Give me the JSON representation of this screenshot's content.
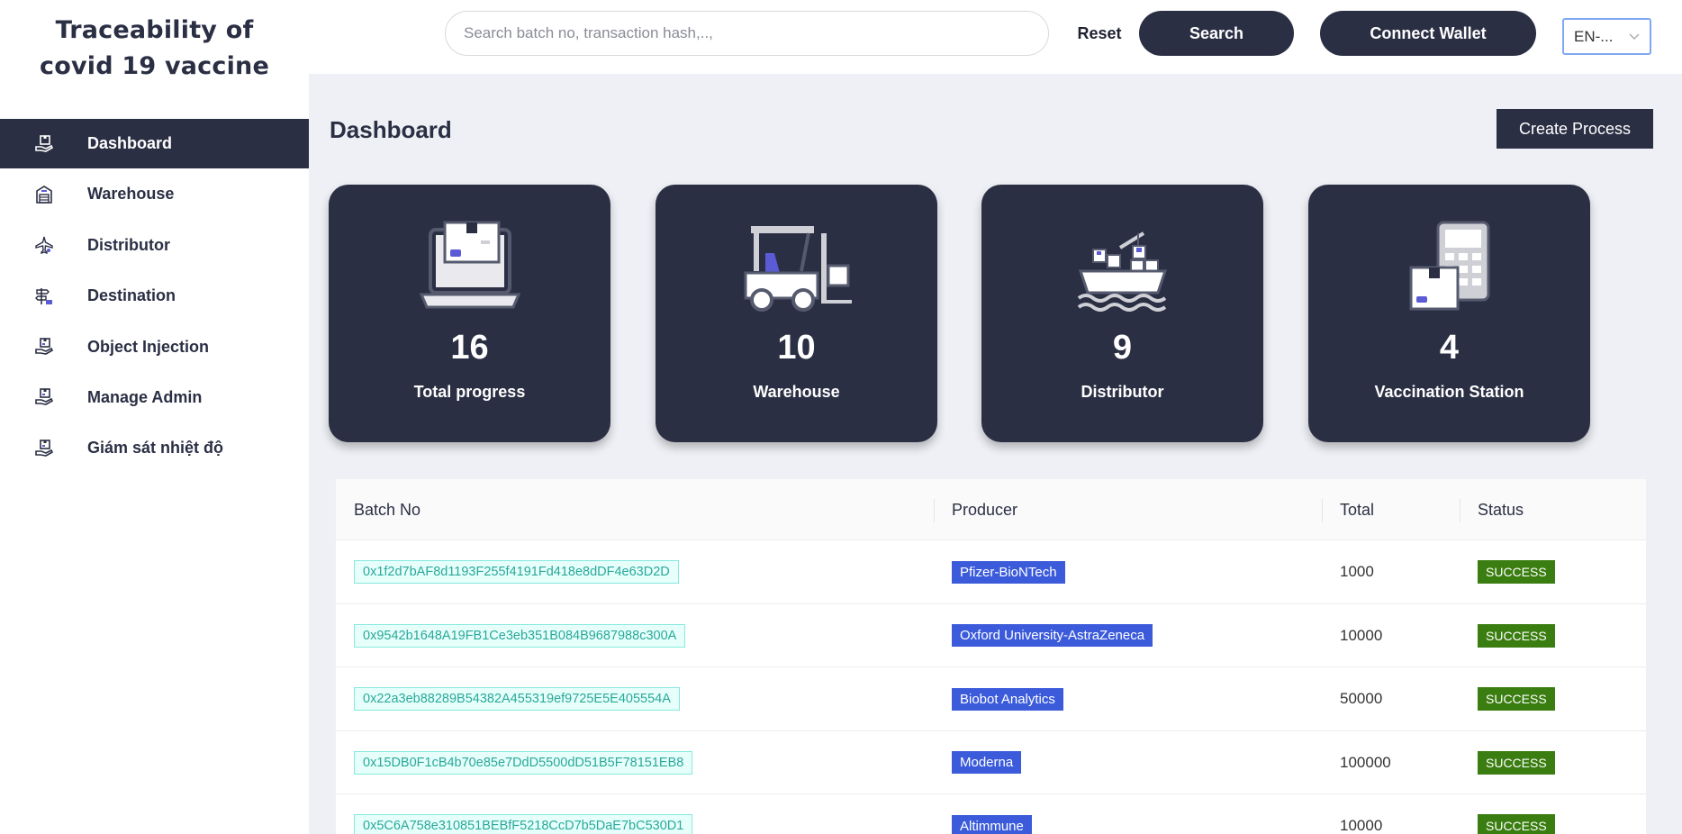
{
  "app": {
    "title_line1": "Traceability of",
    "title_line2": "covid 19 vaccine"
  },
  "sidebar": {
    "items": [
      {
        "label": "Dashboard",
        "icon": "hand-box-icon",
        "active": true
      },
      {
        "label": "Warehouse",
        "icon": "warehouse-icon",
        "active": false
      },
      {
        "label": "Distributor",
        "icon": "airplane-icon",
        "active": false
      },
      {
        "label": "Destination",
        "icon": "signpost-icon",
        "active": false
      },
      {
        "label": "Object Injection",
        "icon": "hand-box-icon",
        "active": false
      },
      {
        "label": "Manage Admin",
        "icon": "hand-box-icon",
        "active": false
      },
      {
        "label": "Giám sát nhiệt độ",
        "icon": "hand-box-icon",
        "active": false
      }
    ]
  },
  "header": {
    "search_placeholder": "Search batch no, transaction hash,..,",
    "reset_label": "Reset",
    "search_label": "Search",
    "wallet_label": "Connect Wallet",
    "language": "EN-..."
  },
  "main": {
    "title": "Dashboard",
    "create_label": "Create Process",
    "cards": [
      {
        "value": "16",
        "label": "Total progress",
        "icon": "laptop-box-icon"
      },
      {
        "value": "10",
        "label": "Warehouse",
        "icon": "forklift-icon"
      },
      {
        "value": "9",
        "label": "Distributor",
        "icon": "cargo-ship-icon"
      },
      {
        "value": "4",
        "label": "Vaccination Station",
        "icon": "calculator-box-icon"
      }
    ]
  },
  "table": {
    "headers": {
      "batch": "Batch No",
      "producer": "Producer",
      "total": "Total",
      "status": "Status"
    },
    "rows": [
      {
        "batch": "0x1f2d7bAF8d1193F255f4191Fd418e8dDF4e63D2D",
        "producer": "Pfizer-BioNTech",
        "total": "1000",
        "status": "SUCCESS"
      },
      {
        "batch": "0x9542b1648A19FB1Ce3eb351B084B9687988c300A",
        "producer": "Oxford University-AstraZeneca",
        "total": "10000",
        "status": "SUCCESS"
      },
      {
        "batch": "0x22a3eb88289B54382A455319ef9725E5E405554A",
        "producer": "Biobot Analytics",
        "total": "50000",
        "status": "SUCCESS"
      },
      {
        "batch": "0x15DB0F1cB4b70e85e7DdD5500dD51B5F78151EB8",
        "producer": "Moderna",
        "total": "100000",
        "status": "SUCCESS"
      },
      {
        "batch": "0x5C6A758e310851BEBfF5218CcD7b5DaE7bC530D1",
        "producer": "Altimmune",
        "total": "10000",
        "status": "SUCCESS"
      }
    ]
  },
  "colors": {
    "primary": "#2b2f44",
    "accent_purple": "#5b5bd6",
    "producer_tag": "#3b5bdb",
    "success_tag": "#3a7d10",
    "hash_text": "#2aa89a"
  }
}
